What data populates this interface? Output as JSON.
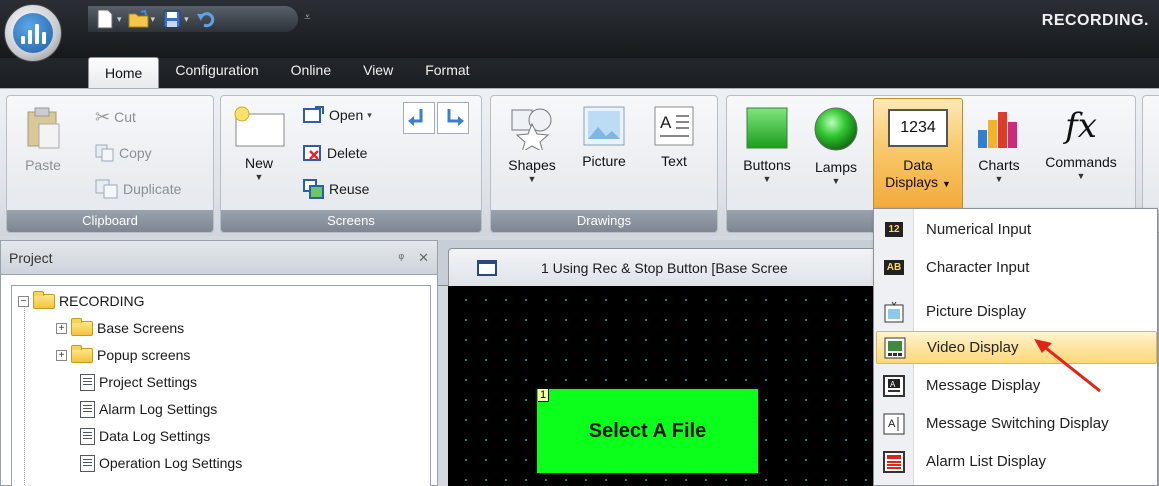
{
  "window": {
    "title": "RECORDING."
  },
  "tabs": [
    "Home",
    "Configuration",
    "Online",
    "View",
    "Format"
  ],
  "ribbon": {
    "clipboard": {
      "label": "Clipboard",
      "paste": "Paste",
      "cut": "Cut",
      "copy": "Copy",
      "duplicate": "Duplicate"
    },
    "screens": {
      "label": "Screens",
      "new": "New",
      "open": "Open",
      "delete": "Delete",
      "reuse": "Reuse"
    },
    "drawings": {
      "label": "Drawings",
      "shapes": "Shapes",
      "picture": "Picture",
      "text": "Text"
    },
    "parts": {
      "buttons": "Buttons",
      "lamps": "Lamps",
      "data_displays_line1": "Data",
      "data_displays_line2": "Displays",
      "data_displays_icon": "1234",
      "charts": "Charts",
      "commands": "Commands",
      "commands_icon": "fx"
    }
  },
  "project_panel": {
    "title": "Project",
    "pin": "ᵠ",
    "close": "✕",
    "tree": [
      {
        "label": "RECORDING"
      },
      {
        "label": "Base Screens"
      },
      {
        "label": "Popup screens"
      },
      {
        "label": "Project Settings"
      },
      {
        "label": "Alarm Log Settings"
      },
      {
        "label": "Data Log Settings"
      },
      {
        "label": "Operation Log Settings"
      }
    ]
  },
  "screen": {
    "tab_title": "1 Using Rec & Stop Button [Base Scree",
    "button_label": "Select A File",
    "button_index": "1"
  },
  "dropdown": {
    "items": [
      {
        "label": "Numerical Input",
        "icon": "12"
      },
      {
        "label": "Character Input",
        "icon": "AB"
      },
      {
        "label": "Picture Display",
        "icon": "picture-display-icon"
      },
      {
        "label": "Video Display",
        "icon": "video-display-icon"
      },
      {
        "label": "Message Display",
        "icon": "message-display-icon"
      },
      {
        "label": "Message Switching Display",
        "icon": "message-switching-icon"
      },
      {
        "label": "Alarm List Display",
        "icon": "alarm-list-icon"
      }
    ],
    "highlighted": "Video Display"
  },
  "colors": {
    "accent_orange": "#f3aa3c",
    "highlight": "#fde4a0",
    "canvas_button": "#0aff1a",
    "arrow": "#e0241a"
  }
}
